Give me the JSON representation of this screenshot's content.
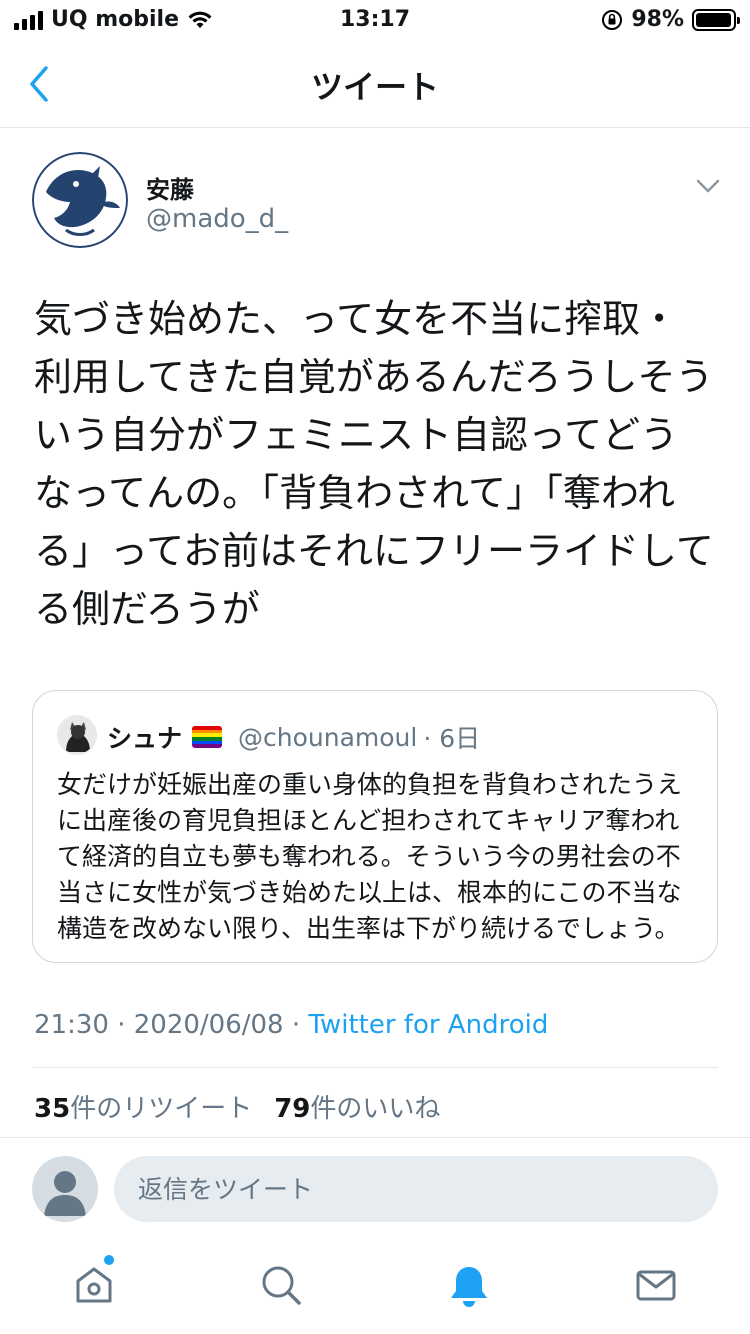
{
  "status_bar": {
    "carrier": "UQ mobile",
    "time": "13:17",
    "battery": "98%",
    "battery_level": 0.98
  },
  "nav": {
    "title": "ツイート",
    "back_icon": "chevron-left-icon"
  },
  "tweet": {
    "author_name": "安藤",
    "author_handle": "@mado_d_",
    "text": "気づき始めた、って女を不当に搾取・利用してきた自覚があるんだろうしそういう自分がフェミニスト自認ってどうなってんの。「背負わされて」「奪われる」ってお前はそれにフリーライドしてる側だろうが",
    "time": "21:30",
    "date": "2020/06/08",
    "separator": "·",
    "source": "Twitter for Android"
  },
  "quote": {
    "name": "シュナ",
    "handle": "@chounamoul",
    "age": "· 6日",
    "text": "女だけが妊娠出産の重い身体的負担を背負わされたうえに出産後の育児負担ほとんど担わされてキャリア奪われて経済的自立も夢も奪われる。そういう今の男社会の不当さに女性が気づき始めた以上は、根本的にこの不当な構造を改めない限り、出生率は下がり続けるでしょう。"
  },
  "stats": {
    "retweet_count": "35",
    "retweet_label": "件のリツイート",
    "like_count": "79",
    "like_label": "件のいいね"
  },
  "reply": {
    "placeholder": "返信をツイート"
  },
  "tabs": {
    "home_icon": "home-icon",
    "search_icon": "search-icon",
    "notifications_icon": "bell-icon",
    "messages_icon": "mail-icon"
  },
  "colors": {
    "accent": "#1da1f2",
    "secondary_text": "#657786",
    "border": "#e1e8ed",
    "avatar_bird": "#24446f"
  }
}
